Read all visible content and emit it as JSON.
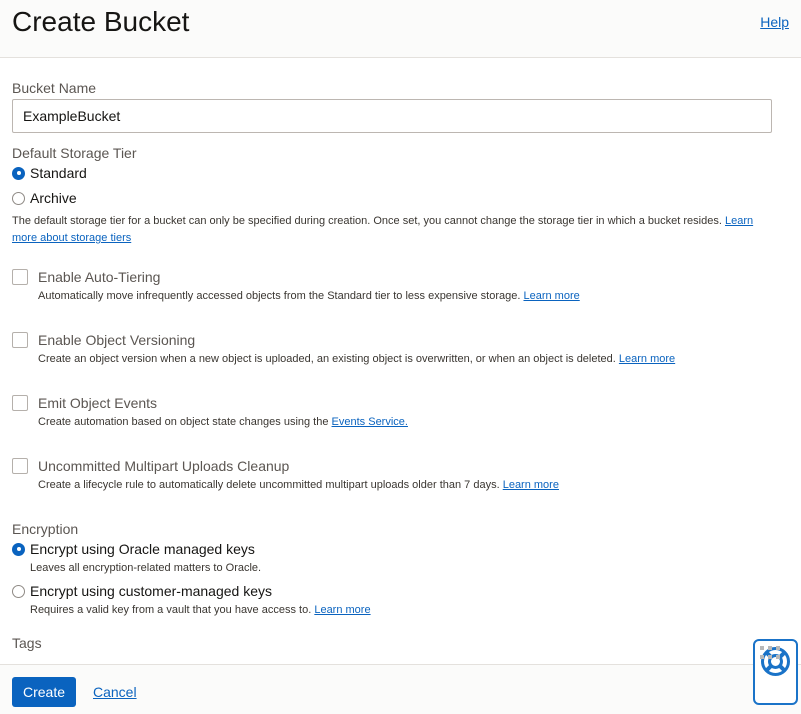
{
  "header": {
    "title": "Create Bucket",
    "help_label": "Help"
  },
  "bucket_name": {
    "label": "Bucket Name",
    "value": "ExampleBucket"
  },
  "storage_tier": {
    "label": "Default Storage Tier",
    "options": [
      {
        "label": "Standard",
        "selected": true
      },
      {
        "label": "Archive",
        "selected": false
      }
    ],
    "help_text": "The default storage tier for a bucket can only be specified during creation. Once set, you cannot change the storage tier in which a bucket resides.",
    "learn_more_part1": "Learn",
    "learn_more_part2": "more about storage tiers"
  },
  "options": [
    {
      "label": "Enable Auto-Tiering",
      "checked": false,
      "description": "Automatically move infrequently accessed objects from the Standard tier to less expensive storage.",
      "link": "Learn more"
    },
    {
      "label": "Enable Object Versioning",
      "checked": false,
      "description": "Create an object version when a new object is uploaded, an existing object is overwritten, or when an object is deleted.",
      "link": "Learn more"
    },
    {
      "label": "Emit Object Events",
      "checked": false,
      "description": "Create automation based on object state changes using the",
      "link": "Events Service."
    },
    {
      "label": "Uncommitted Multipart Uploads Cleanup",
      "checked": false,
      "description": "Create a lifecycle rule to automatically delete uncommitted multipart uploads older than 7 days.",
      "link": "Learn more"
    }
  ],
  "encryption": {
    "label": "Encryption",
    "options": [
      {
        "label": "Encrypt using Oracle managed keys",
        "selected": true,
        "description": "Leaves all encryption-related matters to Oracle.",
        "link": ""
      },
      {
        "label": "Encrypt using customer-managed keys",
        "selected": false,
        "description": "Requires a valid key from a vault that you have access to.",
        "link": "Learn more"
      }
    ]
  },
  "tags": {
    "label": "Tags"
  },
  "footer": {
    "create_label": "Create",
    "cancel_label": "Cancel"
  },
  "help_widget": {
    "icon": "lifebuoy-icon",
    "secondary_icon": "grid-dots-icon"
  },
  "colors": {
    "accent": "#0a63bf",
    "text": "#161513",
    "muted": "#5b5652"
  }
}
